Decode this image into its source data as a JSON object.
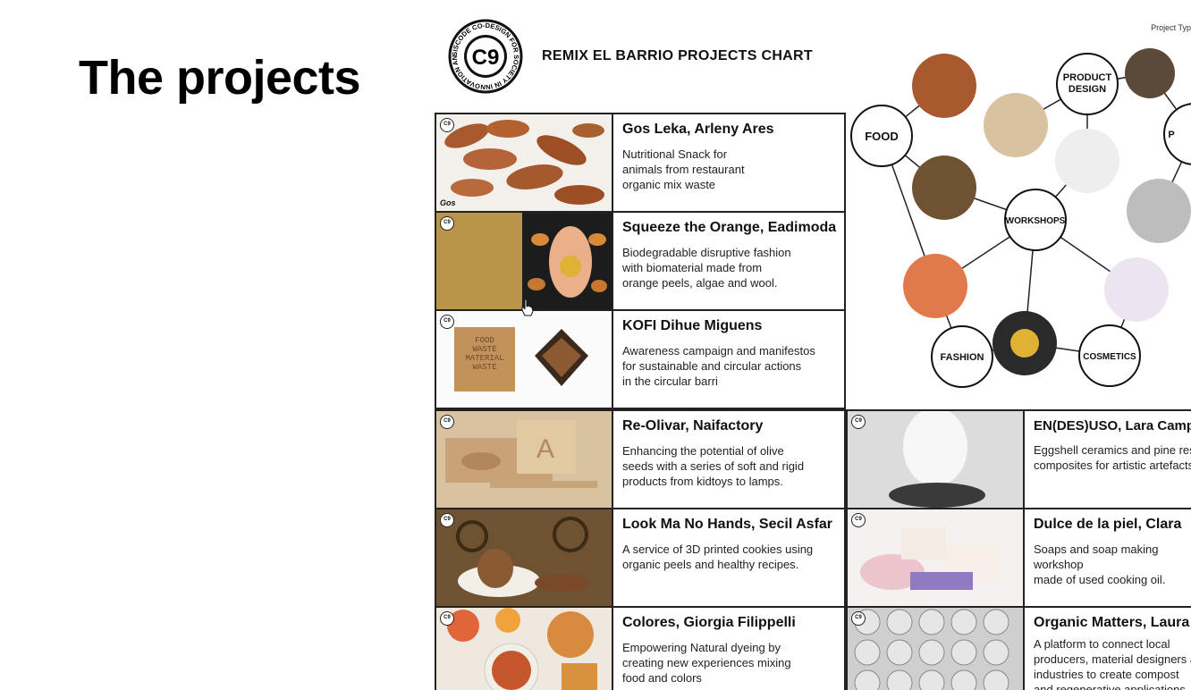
{
  "slide": {
    "title": "The projects"
  },
  "chart": {
    "logo_text": "C9",
    "logo_ring_text": "SISCODE CO-DESIGN FOR SOCIETY IN INNOVATION AND SCIENCE",
    "title": "REMIX EL BARRIO PROJECTS CHART",
    "legend_hint": "Project Typ"
  },
  "projects_left": [
    {
      "name": "Gos Leka, Arleny Ares",
      "desc": "Nutritional Snack for\nanimals from restaurant\norganic mix waste",
      "img_text": "Gos"
    },
    {
      "name": "Squeeze the Orange, Eadimoda",
      "desc": "Biodegradable disruptive fashion\nwith biomaterial  made from\norange peels, algae and wool."
    },
    {
      "name": "KOFI      Dihue Miguens",
      "desc": "Awareness campaign and manifestos\nfor  sustainable and circular actions\nin the circular barri",
      "img_text": "FOOD\nWASTE\nMATERIAL\nWASTE"
    },
    {
      "name": "Re-Olivar, Naifactory",
      "desc": "Enhancing the potential of olive\nseeds with a series of soft and rigid\nproducts from kidtoys to lamps."
    },
    {
      "name": "Look Ma No Hands, Secil Asfar",
      "desc": "A service of 3D printed cookies using\norganic peels and healthy recipes."
    },
    {
      "name": "Colores, Giorgia Filippelli",
      "desc": "Empowering Natural dyeing by\ncreating new experiences mixing\nfood and colors"
    }
  ],
  "projects_right": [
    {
      "name": "EN(DES)USO, Lara Campos",
      "desc": "Eggshell ceramics and pine resin\ncomposites for artistic artefacts"
    },
    {
      "name": "Dulce de la piel, Clara",
      "desc": "Soaps and soap making workshop\nmade of used cooking oil."
    },
    {
      "name": "Organic Matters, Laura",
      "desc": "A platform to connect local\nproducers, material designers and\nindustries to create compost\nand regenerative applications"
    }
  ],
  "network": {
    "nodes": [
      "FOOD",
      "PRODUCT\nDESIGN",
      "WORKSHOPS",
      "FASHION",
      "COSMETICS",
      "P"
    ]
  },
  "colors": {
    "border": "#222222",
    "cookie": "#a0522d",
    "orange": "#e07a2a",
    "stone": "#9a9a9a"
  }
}
